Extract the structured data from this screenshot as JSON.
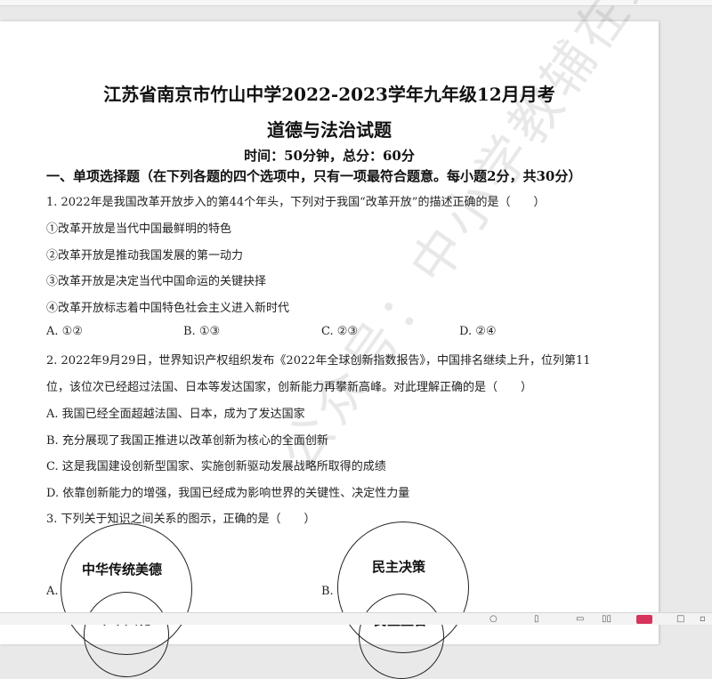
{
  "document": {
    "title_line1": "江苏省南京市竹山中学2022-2023学年九年级12月月考",
    "title_line2": "道德与法治试题",
    "meta": "时间：50分钟，总分：60分",
    "section_heading": "一、单项选择题（在下列各题的四个选项中，只有一项最符合题意。每小题2分，共30分）",
    "watermark": "公众号：中小学教辅在线",
    "q1": {
      "stem": "1. 2022年是我国改革开放步入的第44个年头，下列对于我国“改革开放”的描述正确的是（　　）",
      "items": [
        "①改革开放是当代中国最鲜明的特色",
        "②改革开放是推动我国发展的第一动力",
        "③改革开放是决定当代中国命运的关键抉择",
        "④改革开放标志着中国特色社会主义进入新时代"
      ],
      "options": [
        "A. ①②",
        "B. ①③",
        "C. ②③",
        "D. ②④"
      ]
    },
    "q2": {
      "stem_line1": "2. 2022年9月29日，世界知识产权组织发布《2022年全球创新指数报告》，中国排名继续上升，位列第11",
      "stem_line2": "位，该位次已经超过法国、日本等发达国家，创新能力再攀新高峰。对此理解正确的是（　　）",
      "options": [
        "A. 我国已经全面超越法国、日本，成为了发达国家",
        "B. 充分展现了我国正推进以改革创新为核心的全面创新",
        "C. 这是我国建设创新型国家、实施创新驱动发展战略所取得的成绩",
        "D. 依靠创新能力的增强，我国已经成为影响世界的关键性、决定性力量"
      ]
    },
    "q3": {
      "stem": "3. 下列关于知识之间关系的图示，正确的是（　　）",
      "diagram_a": {
        "label": "A.",
        "outer": "中华传统美德",
        "inner": "中华文化"
      },
      "diagram_b": {
        "label": "B.",
        "outer": "民主决策",
        "inner": "民主监督"
      }
    }
  },
  "colors": {
    "page": "#ffffff",
    "background": "#e9e9e9",
    "text": "#222222"
  },
  "toolbar": {
    "icons": [
      "zoom-out-icon",
      "single-page-icon",
      "page-view-icon",
      "two-page-icon",
      "red-badge-icon",
      "fit-icon",
      "more-icon"
    ]
  }
}
